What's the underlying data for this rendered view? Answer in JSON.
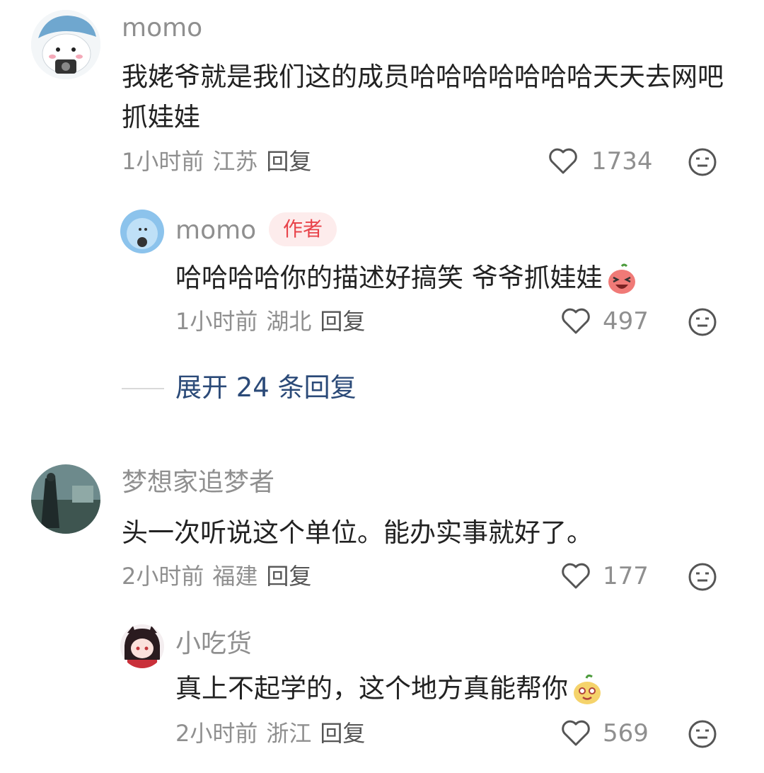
{
  "comments": [
    {
      "username": "momo",
      "text": "我姥爷就是我们这的成员哈哈哈哈哈哈哈天天去网吧抓娃娃",
      "time": "1小时前",
      "location": "江苏",
      "reply_label": "回复",
      "likes": "1734",
      "reply": {
        "username": "momo",
        "badge": "作者",
        "text": "哈哈哈哈你的描述好搞笑 爷爷抓娃娃",
        "time": "1小时前",
        "location": "湖北",
        "reply_label": "回复",
        "likes": "497"
      },
      "expand_label": "展开 24 条回复"
    },
    {
      "username": "梦想家追梦者",
      "text": "头一次听说这个单位。能办实事就好了。",
      "time": "2小时前",
      "location": "福建",
      "reply_label": "回复",
      "likes": "177",
      "reply": {
        "username": "小吃货",
        "text": "真上不起学的，这个地方真能帮你",
        "time": "2小时前",
        "location": "浙江",
        "reply_label": "回复",
        "likes": "569"
      }
    }
  ],
  "colors": {
    "accent_link": "#2b4a78",
    "badge_text": "#e8434a",
    "badge_bg": "#fdecec"
  },
  "icons": [
    "heart-icon",
    "dislike-face-icon",
    "laugh-emoji",
    "smile-emoji"
  ]
}
